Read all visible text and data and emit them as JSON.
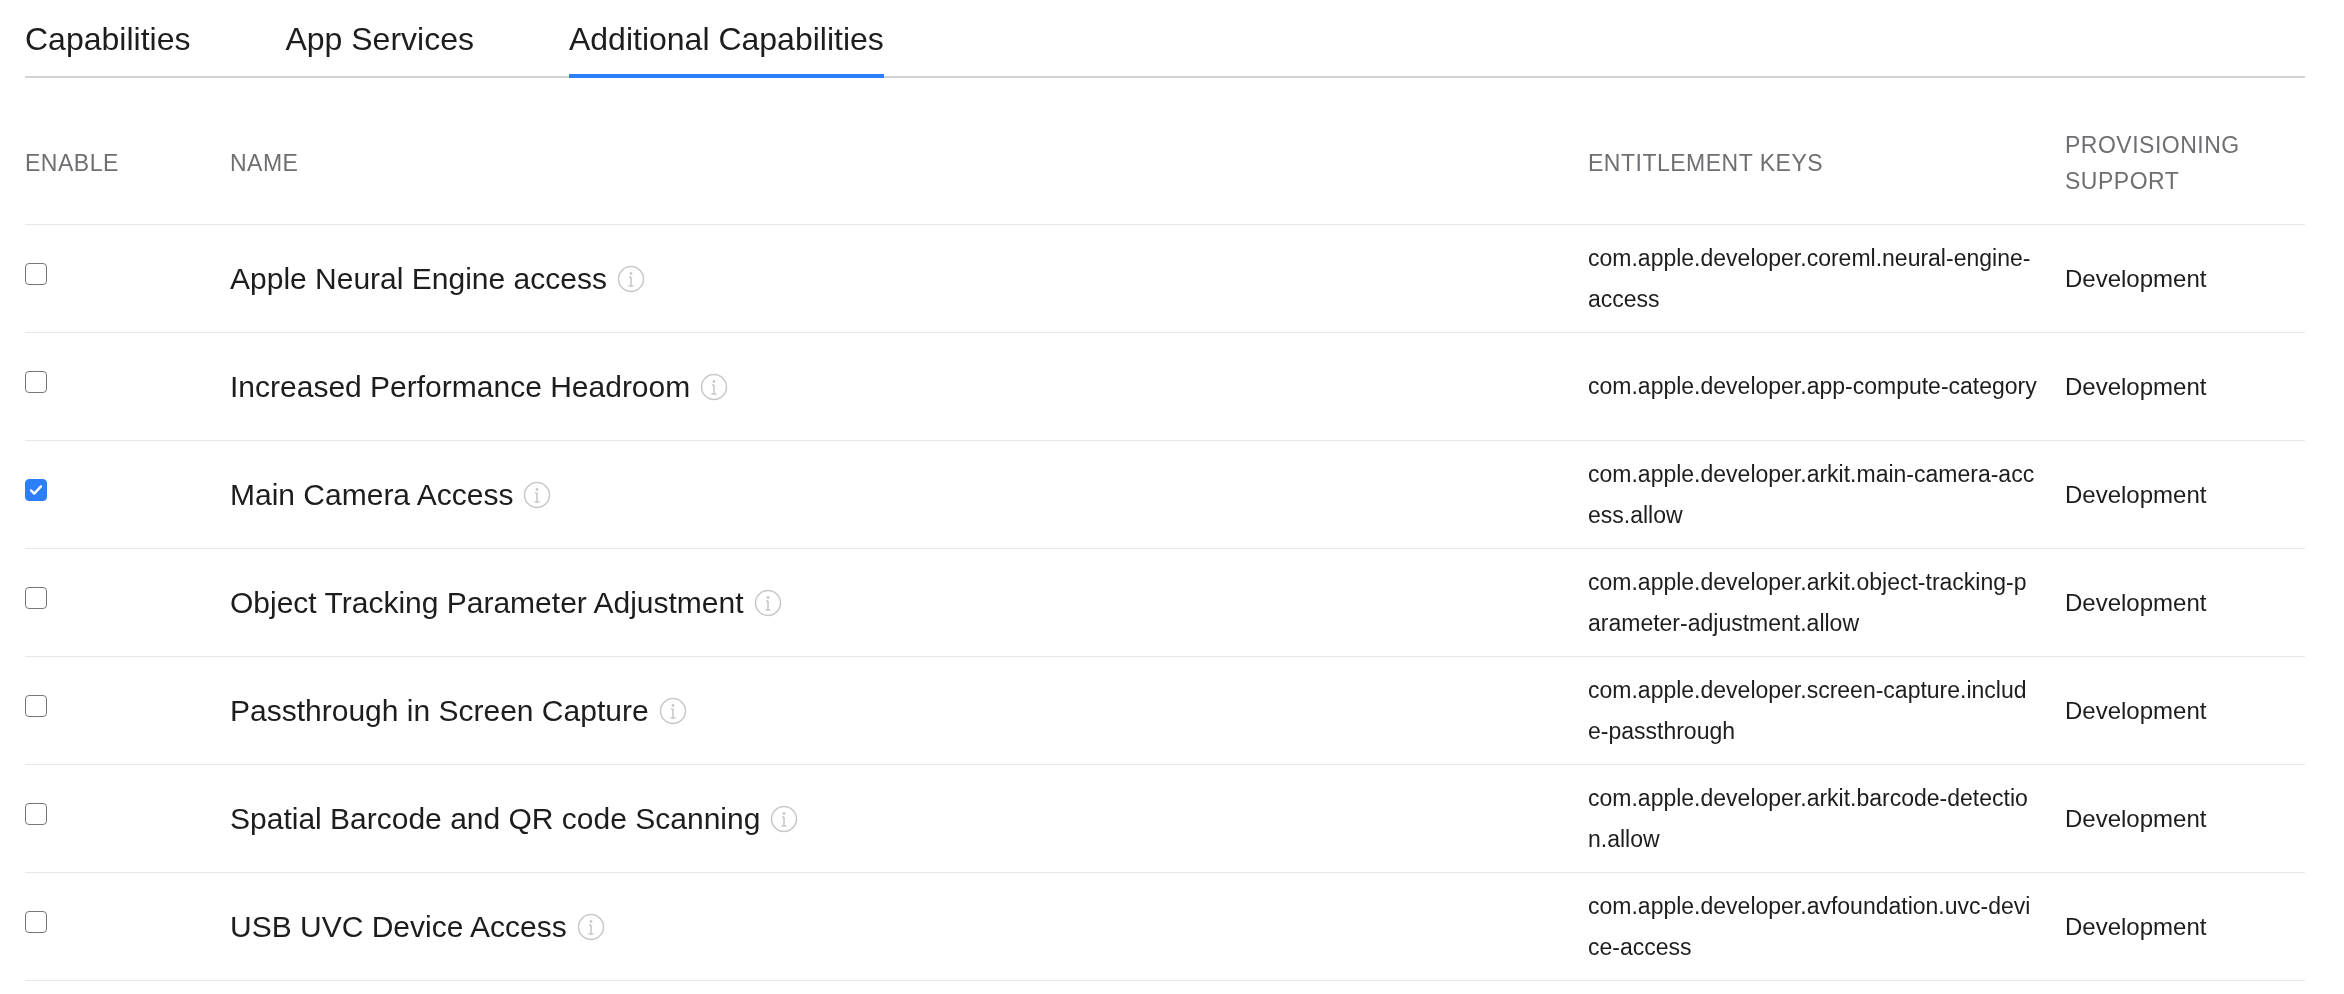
{
  "tabs": [
    {
      "label": "Capabilities",
      "selected": false
    },
    {
      "label": "App Services",
      "selected": false
    },
    {
      "label": "Additional Capabilities",
      "selected": true
    }
  ],
  "table": {
    "columns": [
      "ENABLE",
      "NAME",
      "ENTITLEMENT KEYS",
      "PROVISIONING SUPPORT"
    ],
    "rows": [
      {
        "checked": false,
        "name": "Apple Neural Engine access",
        "key": "com.apple.developer.coreml.neural-engine-access",
        "support": "Development"
      },
      {
        "checked": false,
        "name": "Increased Performance Headroom",
        "key": "com.apple.developer.app-compute-category",
        "support": "Development"
      },
      {
        "checked": true,
        "name": "Main Camera Access",
        "key": "com.apple.developer.arkit.main-camera-access.allow",
        "support": "Development"
      },
      {
        "checked": false,
        "name": "Object Tracking Parameter Adjustment",
        "key": "com.apple.developer.arkit.object-tracking-parameter-adjustment.allow",
        "support": "Development"
      },
      {
        "checked": false,
        "name": "Passthrough in Screen Capture",
        "key": "com.apple.developer.screen-capture.include-passthrough",
        "support": "Development"
      },
      {
        "checked": false,
        "name": "Spatial Barcode and QR code Scanning",
        "key": "com.apple.developer.arkit.barcode-detection.allow",
        "support": "Development"
      },
      {
        "checked": false,
        "name": "USB UVC Device Access",
        "key": "com.apple.developer.avfoundation.uvc-device-access",
        "support": "Development"
      }
    ]
  }
}
